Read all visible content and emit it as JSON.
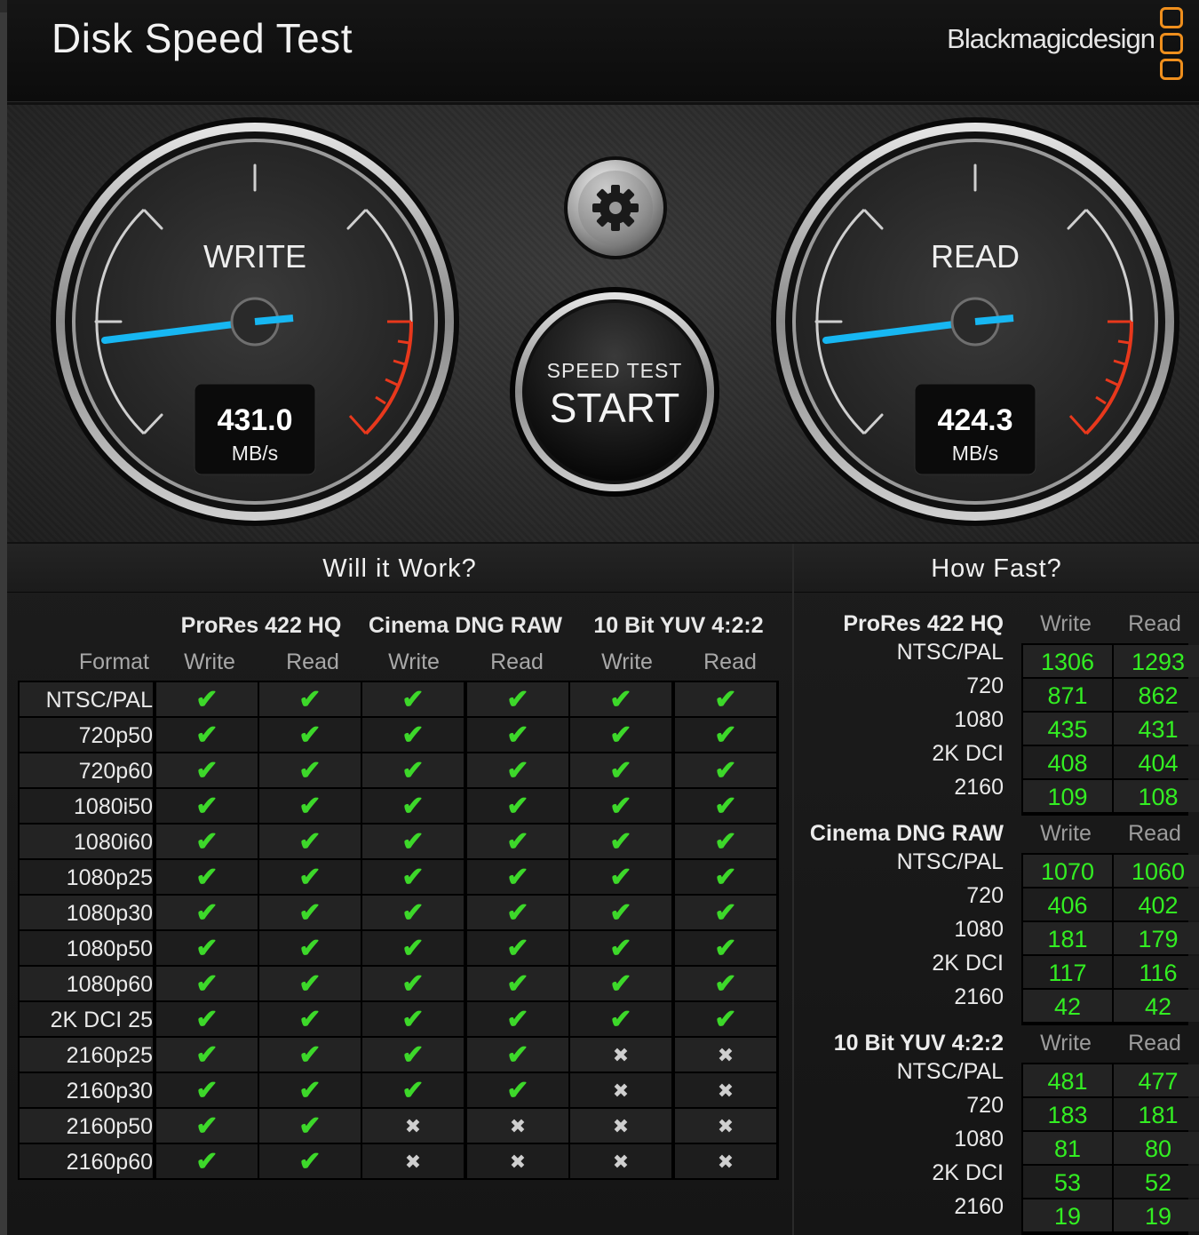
{
  "window": {
    "close_glyph": "×"
  },
  "header": {
    "title": "Disk Speed Test",
    "brand": "Blackmagicdesign",
    "brand_color": "#ef8f1d"
  },
  "gauges": {
    "write": {
      "label": "WRITE",
      "value": "431.0",
      "unit": "MB/s"
    },
    "read": {
      "label": "READ",
      "value": "424.3",
      "unit": "MB/s"
    },
    "needle_color": "#17b7f2",
    "danger_color": "#e8381c"
  },
  "settings_icon": "gear-icon",
  "start_button": {
    "line1": "SPEED TEST",
    "line2": "START"
  },
  "will_it_work": {
    "title": "Will it Work?",
    "format_header": "Format",
    "codecs": [
      "ProRes 422 HQ",
      "Cinema DNG RAW",
      "10 Bit YUV 4:2:2"
    ],
    "col_write": "Write",
    "col_read": "Read",
    "rows": [
      {
        "format": "NTSC/PAL",
        "results": [
          1,
          1,
          1,
          1,
          1,
          1
        ]
      },
      {
        "format": "720p50",
        "results": [
          1,
          1,
          1,
          1,
          1,
          1
        ]
      },
      {
        "format": "720p60",
        "results": [
          1,
          1,
          1,
          1,
          1,
          1
        ]
      },
      {
        "format": "1080i50",
        "results": [
          1,
          1,
          1,
          1,
          1,
          1
        ]
      },
      {
        "format": "1080i60",
        "results": [
          1,
          1,
          1,
          1,
          1,
          1
        ]
      },
      {
        "format": "1080p25",
        "results": [
          1,
          1,
          1,
          1,
          1,
          1
        ]
      },
      {
        "format": "1080p30",
        "results": [
          1,
          1,
          1,
          1,
          1,
          1
        ]
      },
      {
        "format": "1080p50",
        "results": [
          1,
          1,
          1,
          1,
          1,
          1
        ]
      },
      {
        "format": "1080p60",
        "results": [
          1,
          1,
          1,
          1,
          1,
          1
        ]
      },
      {
        "format": "2K DCI 25",
        "results": [
          1,
          1,
          1,
          1,
          1,
          1
        ]
      },
      {
        "format": "2160p25",
        "results": [
          1,
          1,
          1,
          1,
          0,
          0
        ]
      },
      {
        "format": "2160p30",
        "results": [
          1,
          1,
          1,
          1,
          0,
          0
        ]
      },
      {
        "format": "2160p50",
        "results": [
          1,
          1,
          0,
          0,
          0,
          0
        ]
      },
      {
        "format": "2160p60",
        "results": [
          1,
          1,
          0,
          0,
          0,
          0
        ]
      }
    ],
    "check_glyph": "✔",
    "cross_glyph": "✖",
    "check_color": "#3dd82a"
  },
  "how_fast": {
    "title": "How Fast?",
    "col_write": "Write",
    "col_read": "Read",
    "groups": [
      {
        "name": "ProRes 422 HQ",
        "rows": [
          {
            "label": "NTSC/PAL",
            "write": "1306",
            "read": "1293"
          },
          {
            "label": "720",
            "write": "871",
            "read": "862"
          },
          {
            "label": "1080",
            "write": "435",
            "read": "431"
          },
          {
            "label": "2K DCI",
            "write": "408",
            "read": "404"
          },
          {
            "label": "2160",
            "write": "109",
            "read": "108"
          }
        ]
      },
      {
        "name": "Cinema DNG RAW",
        "rows": [
          {
            "label": "NTSC/PAL",
            "write": "1070",
            "read": "1060"
          },
          {
            "label": "720",
            "write": "406",
            "read": "402"
          },
          {
            "label": "1080",
            "write": "181",
            "read": "179"
          },
          {
            "label": "2K DCI",
            "write": "117",
            "read": "116"
          },
          {
            "label": "2160",
            "write": "42",
            "read": "42"
          }
        ]
      },
      {
        "name": "10 Bit YUV 4:2:2",
        "rows": [
          {
            "label": "NTSC/PAL",
            "write": "481",
            "read": "477"
          },
          {
            "label": "720",
            "write": "183",
            "read": "181"
          },
          {
            "label": "1080",
            "write": "81",
            "read": "80"
          },
          {
            "label": "2K DCI",
            "write": "53",
            "read": "52"
          },
          {
            "label": "2160",
            "write": "19",
            "read": "19"
          }
        ]
      }
    ],
    "value_color": "#33ee22"
  }
}
